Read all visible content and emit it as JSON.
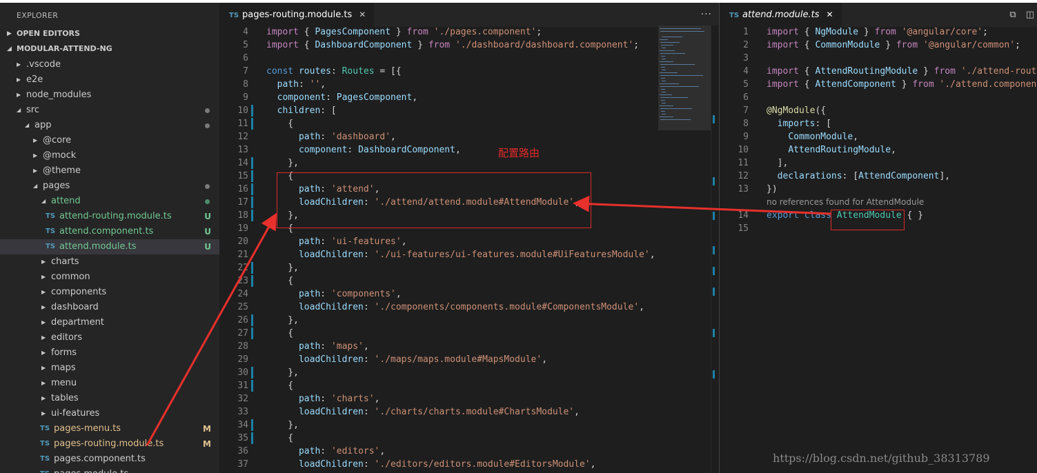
{
  "explorer": {
    "title": "EXPLORER",
    "open_editors": "OPEN EDITORS",
    "project": "MODULAR-ATTEND-NG",
    "tree": [
      {
        "name": ".vscode",
        "depth": 1,
        "kind": "folder",
        "open": false
      },
      {
        "name": "e2e",
        "depth": 1,
        "kind": "folder",
        "open": false
      },
      {
        "name": "node_modules",
        "depth": 1,
        "kind": "folder",
        "open": false
      },
      {
        "name": "src",
        "depth": 1,
        "kind": "folder",
        "open": true,
        "dot": "grey"
      },
      {
        "name": "app",
        "depth": 2,
        "kind": "folder",
        "open": true,
        "dot": "grey"
      },
      {
        "name": "@core",
        "depth": 3,
        "kind": "folder",
        "open": false
      },
      {
        "name": "@mock",
        "depth": 3,
        "kind": "folder",
        "open": false
      },
      {
        "name": "@theme",
        "depth": 3,
        "kind": "folder",
        "open": false
      },
      {
        "name": "pages",
        "depth": 3,
        "kind": "folder",
        "open": true,
        "dot": "grey"
      },
      {
        "name": "attend",
        "depth": 4,
        "kind": "folder",
        "open": true,
        "dot": "green",
        "color": "green"
      },
      {
        "name": "attend-routing.module.ts",
        "depth": 5,
        "kind": "ts",
        "status": "U",
        "color": "green"
      },
      {
        "name": "attend.component.ts",
        "depth": 5,
        "kind": "ts",
        "status": "U",
        "color": "green"
      },
      {
        "name": "attend.module.ts",
        "depth": 5,
        "kind": "ts",
        "status": "U",
        "color": "green",
        "selected": true
      },
      {
        "name": "charts",
        "depth": 4,
        "kind": "folder",
        "open": false
      },
      {
        "name": "common",
        "depth": 4,
        "kind": "folder",
        "open": false
      },
      {
        "name": "components",
        "depth": 4,
        "kind": "folder",
        "open": false
      },
      {
        "name": "dashboard",
        "depth": 4,
        "kind": "folder",
        "open": false
      },
      {
        "name": "department",
        "depth": 4,
        "kind": "folder",
        "open": false
      },
      {
        "name": "editors",
        "depth": 4,
        "kind": "folder",
        "open": false
      },
      {
        "name": "forms",
        "depth": 4,
        "kind": "folder",
        "open": false
      },
      {
        "name": "maps",
        "depth": 4,
        "kind": "folder",
        "open": false
      },
      {
        "name": "menu",
        "depth": 4,
        "kind": "folder",
        "open": false
      },
      {
        "name": "tables",
        "depth": 4,
        "kind": "folder",
        "open": false
      },
      {
        "name": "ui-features",
        "depth": 4,
        "kind": "folder",
        "open": false
      },
      {
        "name": "pages-menu.ts",
        "depth": 4,
        "kind": "ts",
        "status": "M",
        "color": "mod"
      },
      {
        "name": "pages-routing.module.ts",
        "depth": 4,
        "kind": "ts",
        "status": "M",
        "color": "mod"
      },
      {
        "name": "pages.component.ts",
        "depth": 4,
        "kind": "ts"
      },
      {
        "name": "pages.module.ts",
        "depth": 4,
        "kind": "ts"
      }
    ]
  },
  "editor1": {
    "tab_icon": "TS",
    "tab_label": "pages-routing.module.ts",
    "close_icon": "✕",
    "more_icon": "···",
    "lines": [
      {
        "n": "4",
        "html": "<span class=\"c\">import</span> { <span class=\"v\">PagesComponent</span> } <span class=\"c\">from</span> <span class=\"s\">'./pages.component'</span>;"
      },
      {
        "n": "5",
        "html": "<span class=\"c\">import</span> { <span class=\"v\">DashboardComponent</span> } <span class=\"c\">from</span> <span class=\"s\">'./dashboard/dashboard.component'</span>;"
      },
      {
        "n": "6",
        "html": ""
      },
      {
        "n": "7",
        "html": "<span class=\"k\">const</span> <span class=\"v\">routes</span>: <span class=\"t\">Routes</span> = [{"
      },
      {
        "n": "8",
        "html": "  <span class=\"v\">path</span>: <span class=\"s\">''</span>,"
      },
      {
        "n": "9",
        "html": "  <span class=\"v\">component</span>: <span class=\"v\">PagesComponent</span>,"
      },
      {
        "n": "10",
        "html": "  <span class=\"v\">children</span>: [",
        "gutter": true
      },
      {
        "n": "11",
        "html": "    {",
        "gutter": true
      },
      {
        "n": "12",
        "html": "      <span class=\"v\">path</span>: <span class=\"s\">'dashboard'</span>,"
      },
      {
        "n": "13",
        "html": "      <span class=\"v\">component</span>: <span class=\"v\">DashboardComponent</span>,"
      },
      {
        "n": "14",
        "html": "    },",
        "gutter": true
      },
      {
        "n": "15",
        "html": "    {",
        "gutter": true
      },
      {
        "n": "16",
        "html": "      <span class=\"v\">path</span>: <span class=\"s\">'attend'</span>,",
        "gutter": true
      },
      {
        "n": "17",
        "html": "      <span class=\"v\">loadChildren</span>: <span class=\"s\">'./attend/attend.module#AttendModule'</span>,",
        "gutter": true
      },
      {
        "n": "18",
        "html": "    },",
        "gutter": true
      },
      {
        "n": "19",
        "html": "    {"
      },
      {
        "n": "20",
        "html": "      <span class=\"v\">path</span>: <span class=\"s\">'ui-features'</span>,"
      },
      {
        "n": "21",
        "html": "      <span class=\"v\">loadChildren</span>: <span class=\"s\">'./ui-features/ui-features.module#UiFeaturesModule'</span>,"
      },
      {
        "n": "22",
        "html": "    },",
        "gutter": true
      },
      {
        "n": "23",
        "html": "    {",
        "gutter": true
      },
      {
        "n": "24",
        "html": "      <span class=\"v\">path</span>: <span class=\"s\">'components'</span>,"
      },
      {
        "n": "25",
        "html": "      <span class=\"v\">loadChildren</span>: <span class=\"s\">'./components/components.module#ComponentsModule'</span>,"
      },
      {
        "n": "26",
        "html": "    },",
        "gutter": true
      },
      {
        "n": "27",
        "html": "    {",
        "gutter": true
      },
      {
        "n": "28",
        "html": "      <span class=\"v\">path</span>: <span class=\"s\">'maps'</span>,"
      },
      {
        "n": "29",
        "html": "      <span class=\"v\">loadChildren</span>: <span class=\"s\">'./maps/maps.module#MapsModule'</span>,"
      },
      {
        "n": "30",
        "html": "    },",
        "gutter": true
      },
      {
        "n": "31",
        "html": "    {",
        "gutter": true
      },
      {
        "n": "32",
        "html": "      <span class=\"v\">path</span>: <span class=\"s\">'charts'</span>,"
      },
      {
        "n": "33",
        "html": "      <span class=\"v\">loadChildren</span>: <span class=\"s\">'./charts/charts.module#ChartsModule'</span>,"
      },
      {
        "n": "34",
        "html": "    },",
        "gutter": true
      },
      {
        "n": "35",
        "html": "    {",
        "gutter": true
      },
      {
        "n": "36",
        "html": "      <span class=\"v\">path</span>: <span class=\"s\">'editors'</span>,"
      },
      {
        "n": "37",
        "html": "      <span class=\"v\">loadChildren</span>: <span class=\"s\">'./editors/editors.module#EditorsModule'</span>,"
      }
    ]
  },
  "editor2": {
    "tab_icon": "TS",
    "tab_label": "attend.module.ts",
    "close_icon": "✕",
    "lines": [
      {
        "n": "1",
        "html": "<span class=\"c\">import</span> { <span class=\"v\">NgModule</span> } <span class=\"c\">from</span> <span class=\"s\">'@angular/core'</span>;"
      },
      {
        "n": "2",
        "html": "<span class=\"c\">import</span> { <span class=\"v\">CommonModule</span> } <span class=\"c\">from</span> <span class=\"s\">'@angular/common'</span>;"
      },
      {
        "n": "3",
        "html": ""
      },
      {
        "n": "4",
        "html": "<span class=\"c\">import</span> { <span class=\"v\">AttendRoutingModule</span> } <span class=\"c\">from</span> <span class=\"s\">'./attend-routing.module'</span>;"
      },
      {
        "n": "5",
        "html": "<span class=\"c\">import</span> { <span class=\"v\">AttendComponent</span> } <span class=\"c\">from</span> <span class=\"s\">'./attend.component'</span>;"
      },
      {
        "n": "6",
        "html": ""
      },
      {
        "n": "7",
        "html": "<span class=\"d\">@NgModule</span>({"
      },
      {
        "n": "8",
        "html": "  <span class=\"v\">imports</span>: ["
      },
      {
        "n": "9",
        "html": "    <span class=\"v\">CommonModule</span>,"
      },
      {
        "n": "10",
        "html": "    <span class=\"v\">AttendRoutingModule</span>,"
      },
      {
        "n": "11",
        "html": "  ],"
      },
      {
        "n": "12",
        "html": "  <span class=\"v\">declarations</span>: [<span class=\"v\">AttendComponent</span>],"
      },
      {
        "n": "13",
        "html": "})"
      },
      {
        "lens": "no references found for AttendModule"
      },
      {
        "n": "14",
        "html": "<span class=\"k\">export</span> <span class=\"k\">class</span> <span class=\"t\">AttendModule</span> { }"
      },
      {
        "n": "15",
        "html": ""
      }
    ]
  },
  "annotation": {
    "text": "配置路由",
    "color": "#e02a2a"
  },
  "watermark": "https://blog.csdn.net/github_38313789"
}
